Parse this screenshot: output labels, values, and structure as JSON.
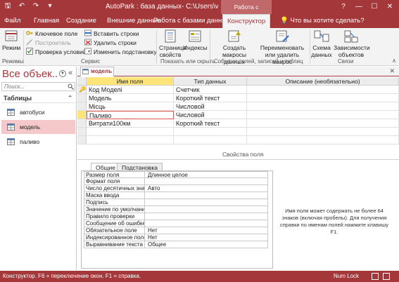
{
  "titlebar": {
    "doc_title": "AutoPark : база данных- C:\\Users\\vs\\Desktop\\AutoP...",
    "tools_title": "Работа с таблицами",
    "window_buttons": [
      "?",
      "—",
      "☐",
      "✕"
    ]
  },
  "tabs": {
    "file": "Файл",
    "home": "Главная",
    "create": "Создание",
    "external": "Внешние данные",
    "database": "Работа с базами данных",
    "design": "Конструктор",
    "tellme": "Что вы хотите сделать?"
  },
  "ribbon": {
    "view": "Режим",
    "primary_key": "Ключевое поле",
    "builder": "Построитель",
    "test_rules": "Проверка условий",
    "insert_rows": "Вставить строки",
    "delete_rows": "Удалить строки",
    "modify_lookups": "Изменить подстановку",
    "property_sheet": "Страница свойств",
    "indexes": "Индексы",
    "create_macros": "Создать макросы данных",
    "rename_macro": "Переименовать или удалить макрос",
    "relationships": "Схема данных",
    "dependencies": "Зависимости объектов",
    "groups": {
      "views": "Режимы",
      "tools": "Сервис",
      "show_hide": "Показать или скрыть",
      "events": "События полей, записей и таблиц",
      "relations": "Связи"
    }
  },
  "navpane": {
    "title": "Все объек...",
    "search_placeholder": "Поиск...",
    "group": "Таблицы",
    "items": [
      "автобуси",
      "модель",
      "паливо"
    ]
  },
  "doc_tab": "модель",
  "grid": {
    "headers": [
      "Имя поля",
      "Тип данных",
      "Описание (необязательно)"
    ],
    "rows": [
      {
        "name": "Код Моделі",
        "type": "Счетчик",
        "desc": ""
      },
      {
        "name": "Модель",
        "type": "Короткий текст",
        "desc": ""
      },
      {
        "name": "Місць",
        "type": "Числовой",
        "desc": ""
      },
      {
        "name": "Паливо",
        "type": "Числовой",
        "desc": ""
      },
      {
        "name": "Витрати100км",
        "type": "Короткий текст",
        "desc": ""
      }
    ]
  },
  "properties": {
    "label": "Свойства поля",
    "tab_general": "Общие",
    "tab_lookup": "Подстановка",
    "rows": [
      {
        "label": "Размер поля",
        "value": "Длинное целое"
      },
      {
        "label": "Формат поля",
        "value": ""
      },
      {
        "label": "Число десятичных знаков",
        "value": "Авто"
      },
      {
        "label": "Маска ввода",
        "value": ""
      },
      {
        "label": "Подпись",
        "value": ""
      },
      {
        "label": "Значение по умолчанию",
        "value": ""
      },
      {
        "label": "Правило проверки",
        "value": ""
      },
      {
        "label": "Сообщение об ошибке",
        "value": ""
      },
      {
        "label": "Обязательное поле",
        "value": "Нет"
      },
      {
        "label": "Индексированное поле",
        "value": "Нет"
      },
      {
        "label": "Выравнивание текста",
        "value": "Общее"
      }
    ],
    "help": "Имя поля может содержать не более 64 знаков (включая пробелы). Для получения справки по именам полей нажмите клавишу F1."
  },
  "status": {
    "text": "Конструктор.  F6 = переключение окон.  F1 = справка.",
    "numlock": "Num Lock"
  },
  "colors": {
    "accent": "#a4373a",
    "header_active": "#fde57a",
    "nav_selected": "#f5c8ca"
  },
  "icons": [
    "save-icon",
    "undo-icon",
    "redo-icon",
    "key-icon",
    "builder-icon",
    "check-icon",
    "insert-rows-icon",
    "delete-rows-icon",
    "lookup-icon",
    "property-sheet-icon",
    "indexes-icon",
    "macro-icon",
    "rename-macro-icon",
    "relationships-icon",
    "dependencies-icon",
    "table-icon",
    "search-icon",
    "lightbulb-icon"
  ]
}
